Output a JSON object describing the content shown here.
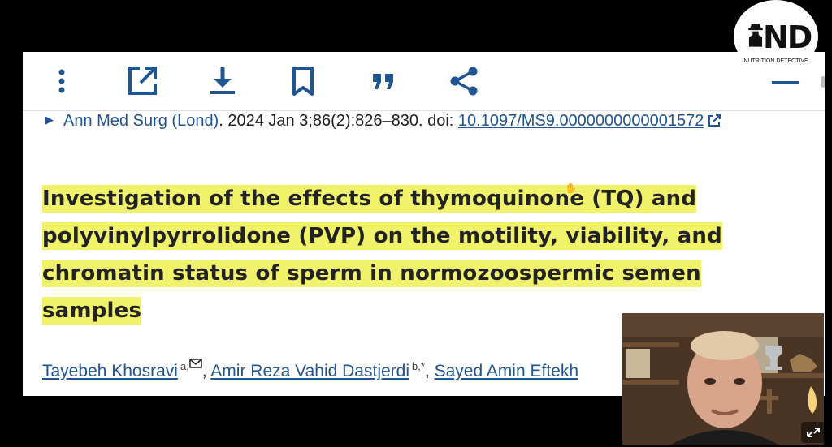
{
  "toolbar": {
    "icons": [
      "more-vertical-icon",
      "open-external-icon",
      "download-icon",
      "bookmark-icon",
      "cite-quote-icon",
      "share-icon"
    ],
    "accent": "#205493"
  },
  "citation": {
    "journal": "Ann Med Surg (Lond)",
    "details": ". 2024 Jan 3;86(2):826–830. doi: ",
    "doi": "10.1097/MS9.0000000000001572"
  },
  "article": {
    "title_lines": [
      "Investigation of the effects of thymoquinone (TQ) and",
      "polyvinylpyrrolidone (PVP) on the motility, viability, and",
      "chromatin status of sperm in normozoospermic semen",
      "samples"
    ],
    "highlight_color": "#f0f26a"
  },
  "authors": [
    {
      "name": "Tayebeh Khosravi",
      "sup": "a,"
    },
    {
      "name": "Amir Reza Vahid Dastjerdi",
      "sup": "b,*"
    },
    {
      "name": "Sayed Amin Eftekh"
    }
  ],
  "separator": ", ",
  "overlay": {
    "logo_text": "ND",
    "logo_subtitle": "NUTRITION DETECTIVE"
  }
}
